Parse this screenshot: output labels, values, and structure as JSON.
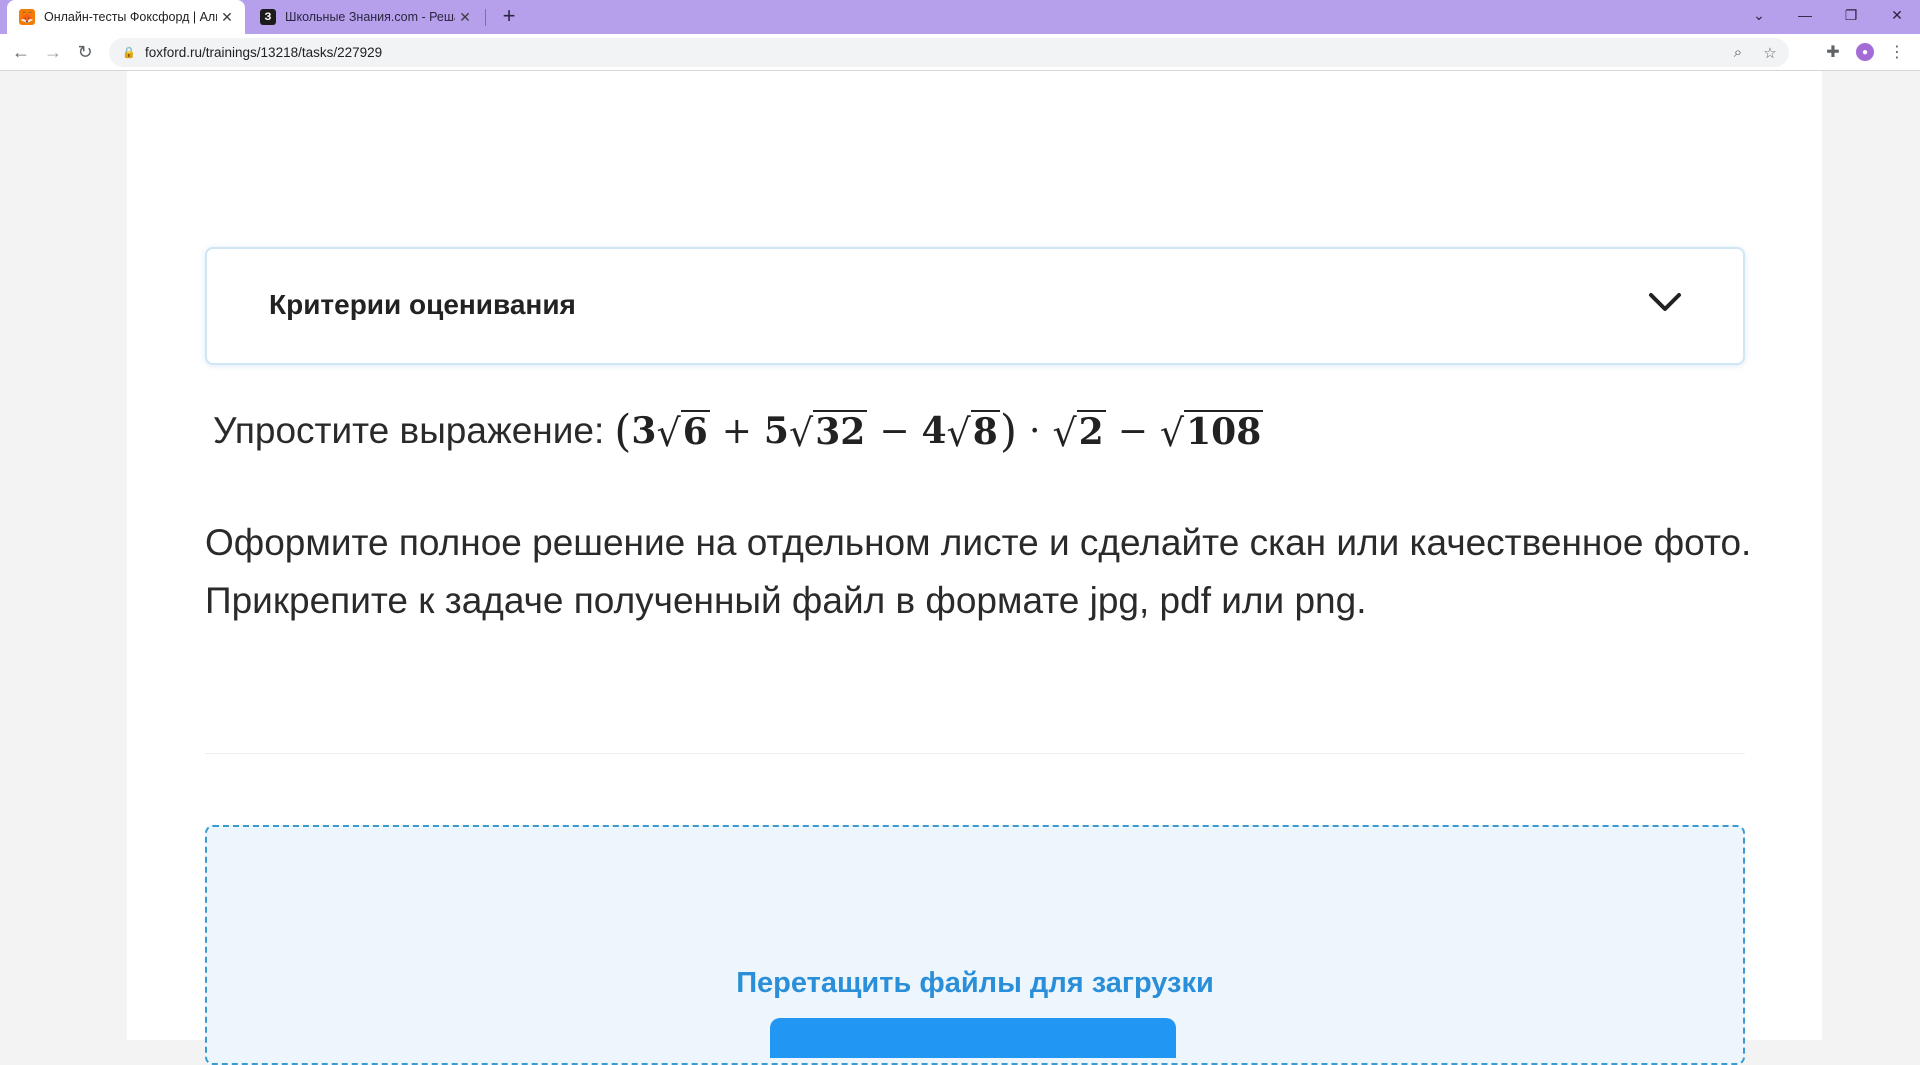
{
  "browser": {
    "tabs": [
      {
        "title": "Онлайн-тесты Фоксфорд | Алгебра",
        "favicon": "foxford-fox-icon",
        "active": true
      },
      {
        "title": "Школьные Знания.com - Решае",
        "favicon": "znania-z-icon",
        "active": false
      }
    ],
    "url": "foxford.ru/trainings/13218/tasks/227929"
  },
  "criteria": {
    "title": "Критерии оценивания",
    "icon": "chevron-down-icon"
  },
  "task": {
    "label": "Упростите выражение:",
    "expression": {
      "open": "(",
      "c1": "3",
      "r1": "6",
      "op1": "+",
      "c2": "5",
      "r2": "32",
      "op2": "−",
      "c3": "4",
      "r3": "8",
      "close": ")",
      "op3": "·",
      "r4": "2",
      "op4": "−",
      "r5": "108"
    }
  },
  "instructions": {
    "line1": "Оформите полное решение на отдельном листе и сделайте скан или качественное фото.",
    "line2": "Прикрепите к задаче полученный файл в формате jpg, pdf или png."
  },
  "upload": {
    "drop_text": "Перетащить файлы для загрузки"
  },
  "colors": {
    "tabbar": "#b6a0ec",
    "accent_blue": "#2196f3",
    "dashed_border": "#3a9bd1"
  }
}
